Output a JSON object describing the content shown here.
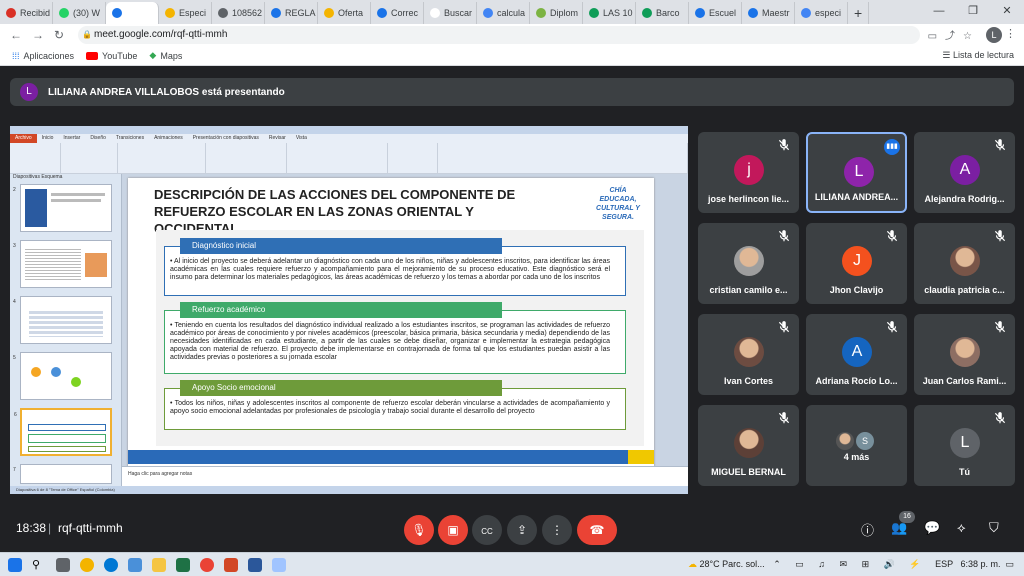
{
  "browser": {
    "tabs": [
      {
        "label": "Recibid",
        "color": "#d93025"
      },
      {
        "label": "(30) W",
        "color": "#25d366"
      },
      {
        "label": "",
        "color": "#1a73e8",
        "active": true
      },
      {
        "label": "Especi",
        "color": "#f4b400"
      },
      {
        "label": "108562",
        "color": "#5f6368"
      },
      {
        "label": "REGLA",
        "color": "#1a73e8"
      },
      {
        "label": "Oferta",
        "color": "#f4b400"
      },
      {
        "label": "Correc",
        "color": "#1a73e8"
      },
      {
        "label": "Buscar",
        "color": "#ffffff"
      },
      {
        "label": "calcula",
        "color": "#4285f4"
      },
      {
        "label": "Diplom",
        "color": "#7cb342"
      },
      {
        "label": "LAS 10",
        "color": "#0f9d58"
      },
      {
        "label": "Barco",
        "color": "#0f9d58"
      },
      {
        "label": "Escuel",
        "color": "#1a73e8"
      },
      {
        "label": "Maestr",
        "color": "#1a73e8"
      },
      {
        "label": "especi",
        "color": "#4285f4"
      }
    ],
    "new_tab": "+",
    "url": "meet.google.com/rqf-qtti-mmh",
    "profile_initial": "L",
    "bookmarks": [
      "Aplicaciones",
      "YouTube",
      "Maps"
    ],
    "reading_list": "Lista de lectura"
  },
  "banner": {
    "avatar": "L",
    "text": "LILIANA ANDREA VILLALOBOS está presentando"
  },
  "presentation": {
    "slide_title": "DESCRIPCIÓN DE LAS ACCIONES DEL COMPONENTE DE REFUERZO ESCOLAR EN LAS ZONAS ORIENTAL Y OCCIDENTAL",
    "logo_text": "CHÍA EDUCADA, CULTURAL Y SEGURA.",
    "sections": [
      {
        "heading": "Diagnóstico inicial",
        "color": "#2f6fb5",
        "text": "• Al inicio del proyecto se deberá adelantar un diagnóstico con cada uno de los niños, niñas y adolescentes inscritos, para identificar las áreas académicas en las cuales requiere refuerzo y acompañamiento para el mejoramiento de su proceso educativo. Este diagnóstico será el insumo para determinar los materiales pedagógicos, las áreas académicas de refuerzo y los temas a abordar por cada uno de los inscritos"
      },
      {
        "heading": "Refuerzo académico",
        "color": "#3faa6a",
        "text": "• Teniendo en cuenta los resultados del diagnóstico individual realizado a los estudiantes inscritos, se programan las actividades de refuerzo académico por áreas de conocimiento y por niveles académicos (preescolar, básica primaria, básica secundaria y media) dependiendo de las necesidades identificadas en cada estudiante, a partir de las cuales se debe diseñar, organizar e implementar la estrategia pedagógica apoyada con material de refuerzo. El proyecto debe implementarse en contrajornada de forma tal que los estudiantes puedan asistir a las actividades previas o posteriores a su jornada escolar"
      },
      {
        "heading": "Apoyo Socio emocional",
        "color": "#6e9b3a",
        "text": "• Todos los niños, niñas y adolescentes inscritos al componente de refuerzo escolar deberán vincularse a actividades de acompañamiento y apoyo socio emocional adelantadas por profesionales de psicología y trabajo social durante el desarrollo del proyecto"
      }
    ],
    "notes_placeholder": "Haga clic para agregar notas",
    "ribbon_tabs": [
      "Archivo",
      "Inicio",
      "Insertar",
      "Diseño",
      "Transiciones",
      "Animaciones",
      "Presentación con diapositivas",
      "Revisar",
      "Vista"
    ],
    "thumb_tabs": "Diapositivas   Esquema",
    "status": "Diapositiva 6 de 8   \"Tema de Office\"   Español (Colombia)"
  },
  "participants": [
    {
      "name": "jose herlincon lie...",
      "initial": "j",
      "color": "#c2185b",
      "muted": true
    },
    {
      "name": "LILIANA ANDREA...",
      "initial": "L",
      "color": "#8e24aa",
      "speaking": true
    },
    {
      "name": "Alejandra Rodrig...",
      "initial": "A",
      "color": "#7b1fa2",
      "muted": true
    },
    {
      "name": "cristian camilo e...",
      "initial": "",
      "color": "#9e9e9e",
      "photo": true,
      "muted": true
    },
    {
      "name": "Jhon Clavijo",
      "initial": "J",
      "color": "#f4511e",
      "muted": true
    },
    {
      "name": "claudia patricia c...",
      "initial": "",
      "color": "#795548",
      "photo": true,
      "muted": true
    },
    {
      "name": "Ivan Cortes",
      "initial": "",
      "color": "#6d4c41",
      "photo": true,
      "muted": true
    },
    {
      "name": "Adriana Rocío Lo...",
      "initial": "A",
      "color": "#1565c0",
      "muted": true
    },
    {
      "name": "Juan Carlos Rami...",
      "initial": "",
      "color": "#8d6e63",
      "photo": true,
      "muted": true
    },
    {
      "name": "MIGUEL BERNAL",
      "initial": "",
      "color": "#5d4037",
      "photo": true,
      "muted": true
    },
    {
      "name": "4 más",
      "initial": "S",
      "color": "#78909c",
      "more": true
    },
    {
      "name": "Tú",
      "initial": "L",
      "color": "#5f6368",
      "muted": true
    }
  ],
  "controls": {
    "time": "18:38",
    "separator": "|",
    "meeting_code": "rqf-qtti-mmh",
    "people_count": "16"
  },
  "taskbar": {
    "weather": "28°C  Parc. sol...",
    "lang": "ESP",
    "time": "6:38 p. m."
  }
}
